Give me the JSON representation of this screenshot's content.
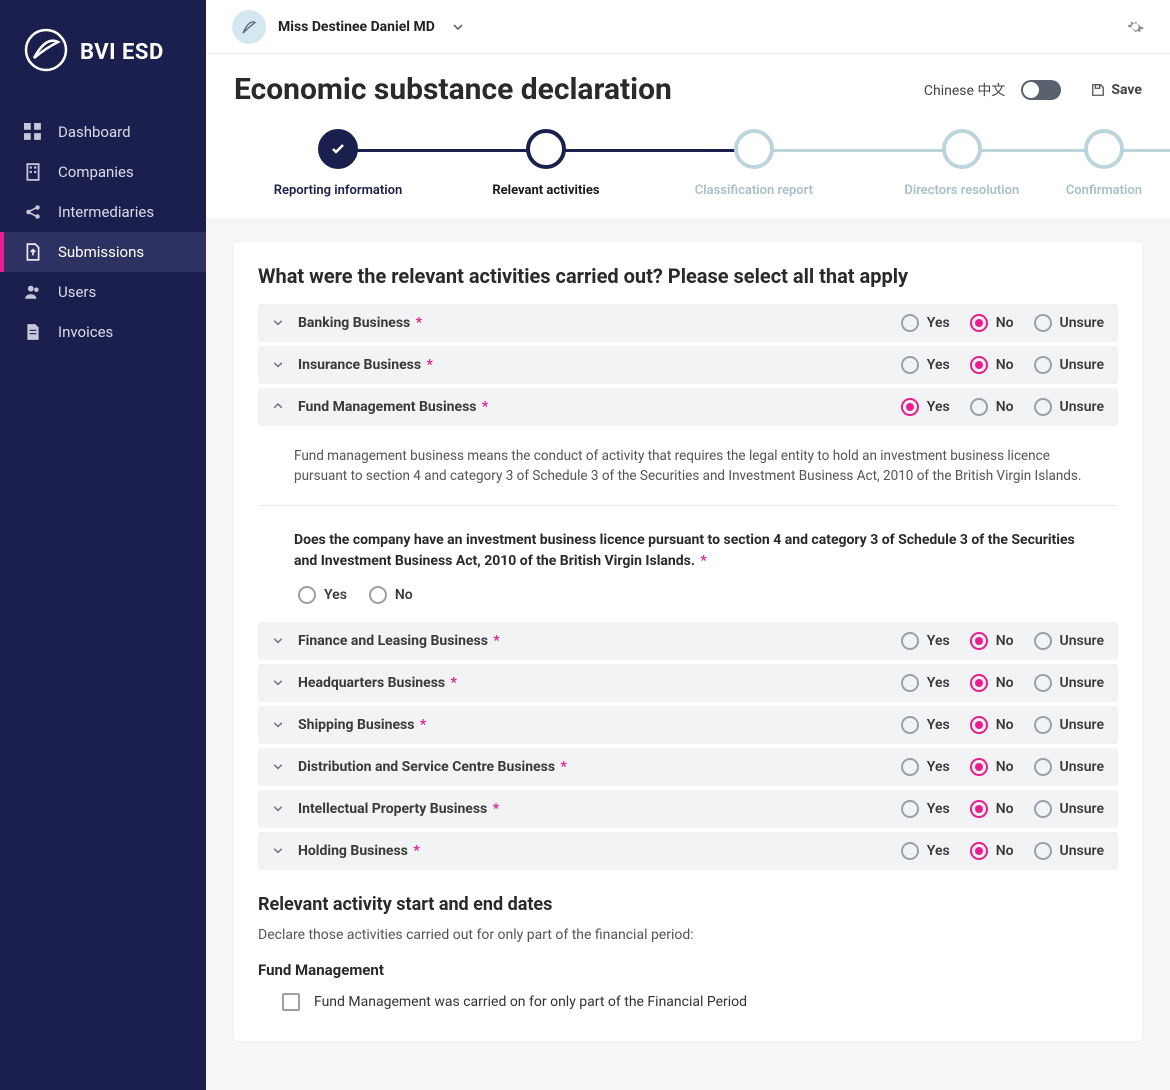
{
  "brand": "BVI ESD",
  "user": {
    "name": "Miss Destinee Daniel MD"
  },
  "nav": {
    "items": [
      {
        "label": "Dashboard"
      },
      {
        "label": "Companies"
      },
      {
        "label": "Intermediaries"
      },
      {
        "label": "Submissions"
      },
      {
        "label": "Users"
      },
      {
        "label": "Invoices"
      }
    ]
  },
  "header": {
    "title": "Economic substance declaration",
    "lang_label": "Chinese 中文",
    "save_label": "Save"
  },
  "stepper": [
    {
      "label": "Reporting information"
    },
    {
      "label": "Relevant activities"
    },
    {
      "label": "Classification report"
    },
    {
      "label": "Directors resolution"
    },
    {
      "label": "Confirmation"
    }
  ],
  "question_title": "What were the relevant activities carried out? Please select all that apply",
  "options": {
    "yes": "Yes",
    "no": "No",
    "unsure": "Unsure"
  },
  "activities": [
    {
      "label": "Banking Business",
      "selected": "no",
      "expanded": false
    },
    {
      "label": "Insurance Business",
      "selected": "no",
      "expanded": false
    },
    {
      "label": "Fund Management Business",
      "selected": "yes",
      "expanded": true,
      "description": "Fund management business means the conduct of activity that requires the legal entity to hold an investment business licence pursuant to section 4 and category 3 of Schedule 3 of the Securities and Investment Business Act, 2010 of the British Virgin Islands.",
      "sub_question": "Does the company have an investment business licence pursuant to section 4 and category 3 of Schedule 3 of the Securities and Investment Business Act, 2010 of the British Virgin Islands."
    },
    {
      "label": "Finance and Leasing Business",
      "selected": "no",
      "expanded": false
    },
    {
      "label": "Headquarters Business",
      "selected": "no",
      "expanded": false
    },
    {
      "label": "Shipping Business",
      "selected": "no",
      "expanded": false
    },
    {
      "label": "Distribution and Service Centre Business",
      "selected": "no",
      "expanded": false
    },
    {
      "label": "Intellectual Property Business",
      "selected": "no",
      "expanded": false
    },
    {
      "label": "Holding Business",
      "selected": "no",
      "expanded": false
    }
  ],
  "dates_section": {
    "title": "Relevant activity start and end dates",
    "subtitle": "Declare those activities carried out for only part of the financial period:",
    "group_label": "Fund Management",
    "checkbox_label": "Fund Management was carried on for only part of the Financial Period"
  }
}
